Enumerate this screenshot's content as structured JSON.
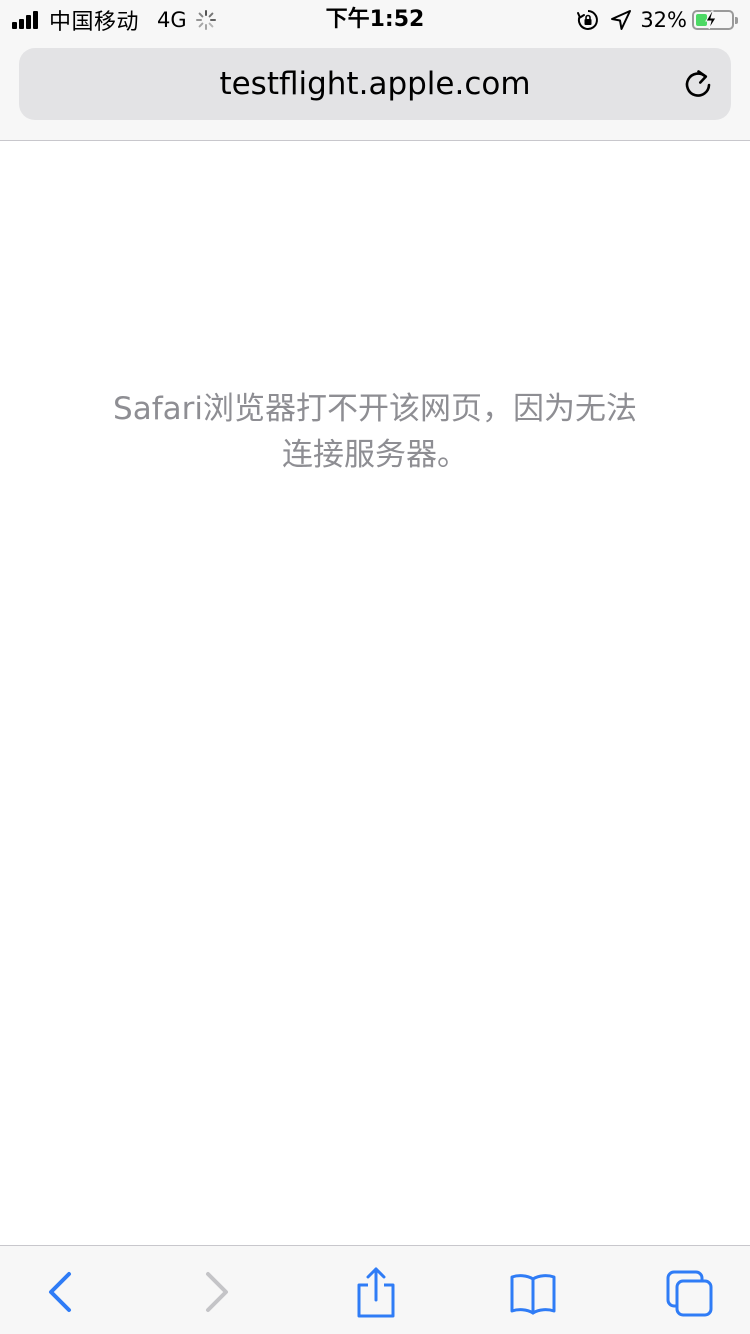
{
  "status_bar": {
    "carrier": "中国移动",
    "network": "4G",
    "time": "下午1:52",
    "battery_percent": "32%",
    "battery_level": 0.32,
    "icons": [
      "signal-bars-icon",
      "activity-spinner-icon",
      "orientation-lock-icon",
      "location-arrow-icon",
      "battery-charging-icon"
    ]
  },
  "address_bar": {
    "url": "testflight.apple.com",
    "reload_icon": "reload-icon"
  },
  "content": {
    "error_message": "Safari浏览器打不开该网页，因为无法连接服务器。"
  },
  "toolbar": {
    "items": [
      {
        "icon": "back-chevron-icon",
        "enabled": true
      },
      {
        "icon": "forward-chevron-icon",
        "enabled": false
      },
      {
        "icon": "share-icon",
        "enabled": true
      },
      {
        "icon": "bookmarks-book-icon",
        "enabled": true
      },
      {
        "icon": "tabs-icon",
        "enabled": true
      }
    ],
    "accent_color": "#2f7cf6",
    "disabled_color": "#c4c4c7"
  }
}
